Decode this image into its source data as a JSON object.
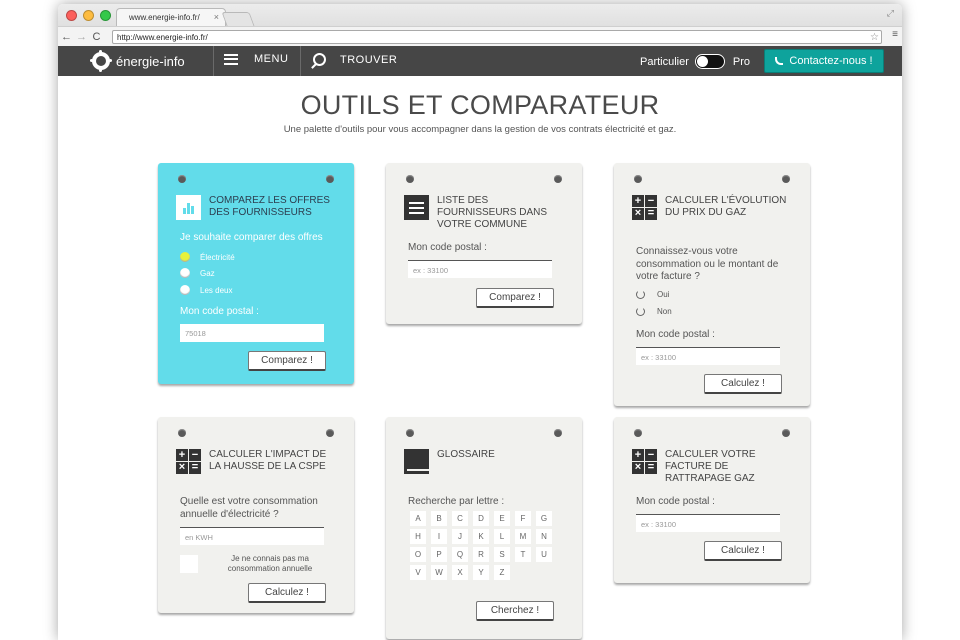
{
  "browser": {
    "tab_title": "www.energie-info.fr/",
    "url": "http://www.energie-info.fr/"
  },
  "header": {
    "logo_text": "énergie-info",
    "menu_label": "MENU",
    "search_label": "TROUVER",
    "toggle_left": "Particulier",
    "toggle_right": "Pro",
    "contact_label": "Contactez-nous !",
    "contact_color": "#0ea39c"
  },
  "page": {
    "title": "OUTILS ET COMPARATEUR",
    "subtitle": "Une palette d'outils pour vous accompagner dans la gestion de vos contrats électricité et gaz."
  },
  "cards": {
    "compare": {
      "title": "COMPAREZ LES OFFRES DES FOURNISSEURS",
      "prompt": "Je souhaite comparer des offres",
      "options": [
        "Électricité",
        "Gaz",
        "Les deux"
      ],
      "postal_label": "Mon code postal :",
      "postal_value": "75018",
      "button": "Comparez !",
      "accent": "#62dcea"
    },
    "suppliers": {
      "title": "LISTE DES FOURNISSEURS DANS VOTRE COMMUNE",
      "postal_label": "Mon code postal :",
      "postal_placeholder": "ex : 33100",
      "button": "Comparez !"
    },
    "gas": {
      "title": "CALCULER L'ÉVOLUTION DU PRIX DU GAZ",
      "question": "Connaissez-vous votre consommation ou le montant de votre facture ?",
      "options": [
        "Oui",
        "Non"
      ],
      "postal_label": "Mon code postal :",
      "postal_placeholder": "ex : 33100",
      "button": "Calculez !"
    },
    "cspe": {
      "title": "CALCULER L'IMPACT DE LA HAUSSE DE LA CSPE",
      "question": "Quelle est votre consommation annuelle d'électricité ?",
      "unit_placeholder": "en KWH",
      "checkbox_label": "Je ne connais pas ma consommation annuelle",
      "button": "Calculez !"
    },
    "glossary": {
      "title": "GLOSSAIRE",
      "search_label": "Recherche par lettre :",
      "letters": [
        "A",
        "B",
        "C",
        "D",
        "E",
        "F",
        "G",
        "H",
        "I",
        "J",
        "K",
        "L",
        "M",
        "N",
        "O",
        "P",
        "Q",
        "R",
        "S",
        "T",
        "U",
        "V",
        "W",
        "X",
        "Y",
        "Z"
      ],
      "button": "Cherchez !"
    },
    "catchup": {
      "title": "CALCULER VOTRE FACTURE DE RATTRAPAGE GAZ",
      "postal_label": "Mon code postal :",
      "postal_placeholder": "ex : 33100",
      "button": "Calculez !"
    }
  }
}
